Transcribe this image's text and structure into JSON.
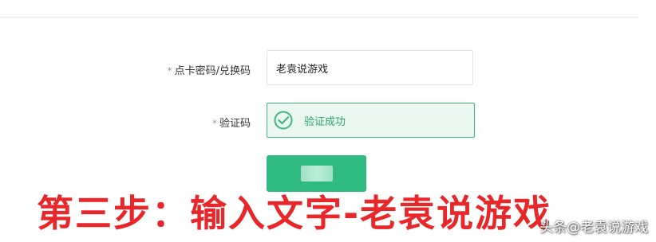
{
  "form": {
    "card_label_required": "*",
    "card_label": "点卡密码/兑换码",
    "card_value": "老袁说游戏",
    "captcha_label_required": "*",
    "captcha_label": "验证码",
    "captcha_status": "验证成功",
    "captcha_status_icon": "check-circle-icon",
    "submit_label": ""
  },
  "overlay": {
    "caption": "第三步：输入文字-老袁说游戏",
    "watermark": "头条@老袁说游戏"
  },
  "colors": {
    "accent_green": "#2fbb7f",
    "success_border": "#3cb67e",
    "caption_red": "#e8272b"
  }
}
